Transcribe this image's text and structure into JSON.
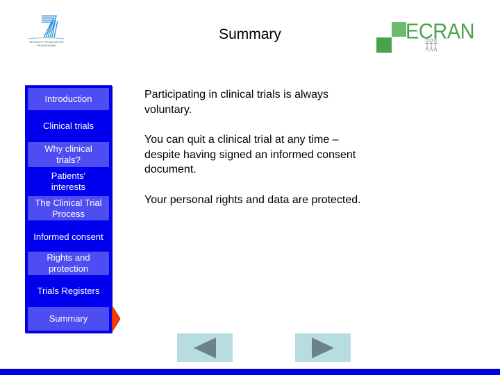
{
  "header": {
    "title": "Summary",
    "left_logo": {
      "icon": "fp7-seven-logo-icon",
      "caption": "SEVENTH FRAMEWORK PROGRAMME",
      "color": "#2a8fd6"
    },
    "right_logo": {
      "text": "ECRAN",
      "icon": "people-figures-icon",
      "color": "#4aa34a"
    }
  },
  "sidebar": {
    "items": [
      {
        "label": "Introduction",
        "style": "light"
      },
      {
        "label": "Clinical trials",
        "style": "dark"
      },
      {
        "label": "Why clinical trials?",
        "style": "light"
      },
      {
        "label": "Patients' interests",
        "style": "dark"
      },
      {
        "label": "The Clinical Trial Process",
        "style": "light"
      },
      {
        "label": "Informed consent",
        "style": "dark"
      },
      {
        "label": "Rights and protection",
        "style": "light"
      },
      {
        "label": "Trials Registers",
        "style": "dark"
      },
      {
        "label": "Summary",
        "style": "light",
        "current": true
      }
    ],
    "current_indicator": "pointer-arrow-icon",
    "colors": {
      "background": "#0000ee",
      "light_item": "#4d4df2",
      "pointer": "#ff3a00"
    }
  },
  "content": {
    "paragraphs": [
      "Participating in clinical trials is always voluntary.",
      "You can quit a clinical trial at any time – despite having signed an informed consent document.",
      "Your personal rights and data are protected."
    ]
  },
  "navigation": {
    "prev": {
      "icon": "triangle-left-icon"
    },
    "next": {
      "icon": "triangle-right-icon"
    },
    "button_color": "#b7dde0",
    "arrow_color": "#6c8285"
  }
}
